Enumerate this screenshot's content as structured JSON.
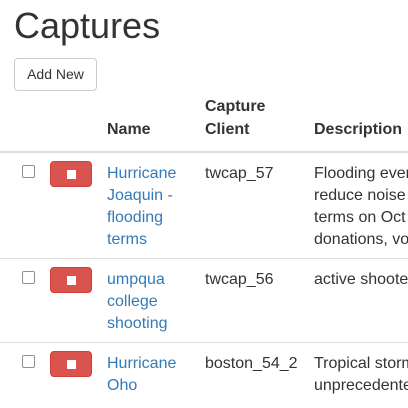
{
  "page": {
    "title": "Captures",
    "add_new_label": "Add New"
  },
  "table": {
    "headers": {
      "name": "Name",
      "client_line1": "Capture",
      "client_line2": "Client",
      "description": "Description"
    },
    "rows": [
      {
        "name": "Hurricane Joaquin - flooding terms",
        "client": "twcap_57",
        "description_lines": [
          "Flooding events",
          "reduce noise",
          "terms on Oct",
          "donations, vo"
        ]
      },
      {
        "name": "umpqua college shooting",
        "client": "twcap_56",
        "description_lines": [
          "active shooter"
        ]
      },
      {
        "name": "Hurricane Oho",
        "client": "boston_54_2",
        "description_lines": [
          "Tropical storm",
          "unprecedented"
        ]
      }
    ]
  },
  "colors": {
    "link": "#337ab7",
    "danger": "#d9534f",
    "text": "#333333",
    "border": "#dddddd"
  },
  "icons": {
    "stop": "stop-icon"
  }
}
